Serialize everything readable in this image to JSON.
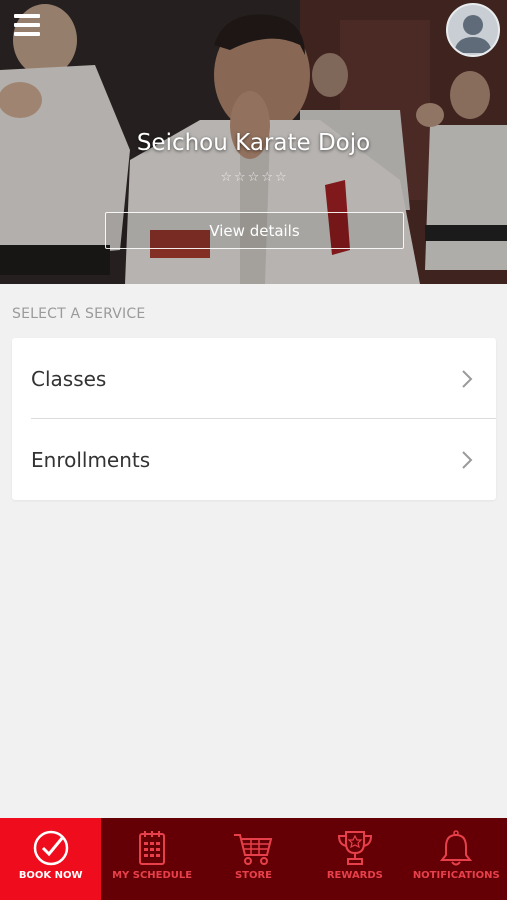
{
  "header": {
    "studio_name": "Seichou Karate Dojo",
    "rating": 0,
    "rating_max": 5,
    "view_details_label": "View details"
  },
  "services": {
    "section_title": "SELECT A SERVICE",
    "items": [
      {
        "label": "Classes"
      },
      {
        "label": "Enrollments"
      }
    ]
  },
  "bottom_nav": {
    "active_index": 0,
    "items": [
      {
        "label": "BOOK NOW",
        "icon": "check-circle-icon"
      },
      {
        "label": "MY SCHEDULE",
        "icon": "calendar-icon"
      },
      {
        "label": "STORE",
        "icon": "cart-icon"
      },
      {
        "label": "REWARDS",
        "icon": "trophy-icon"
      },
      {
        "label": "NOTIFICATIONS",
        "icon": "bell-icon"
      }
    ]
  },
  "colors": {
    "nav_background": "#640005",
    "nav_active": "#ee0c1d",
    "nav_label": "#e8404b",
    "page_background": "#f1f1f1"
  }
}
